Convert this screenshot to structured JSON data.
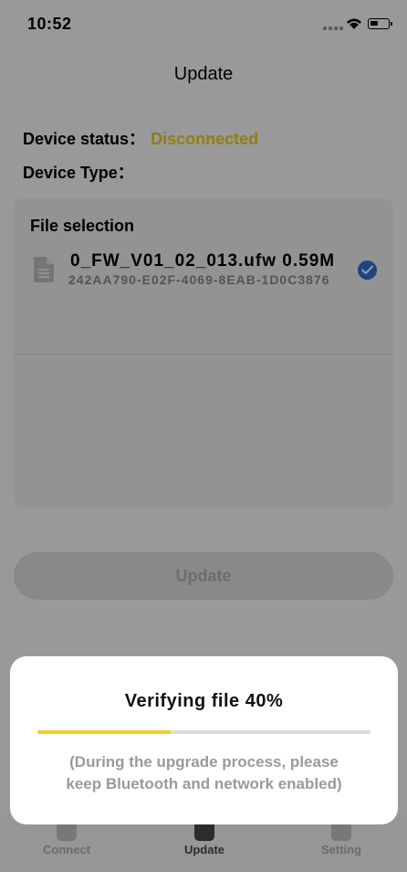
{
  "status_bar": {
    "time": "10:52"
  },
  "nav": {
    "title": "Update"
  },
  "device": {
    "status_label": "Device status：",
    "status_value": "Disconnected",
    "status_color": "#f2d21c",
    "type_label": "Device Type："
  },
  "file_selection": {
    "title": "File selection",
    "files": [
      {
        "name": "0_FW_V01_02_013.ufw  0.59M",
        "id": "242AA790-E02F-4069-8EAB-1D0C3876",
        "selected": true
      }
    ]
  },
  "update_button": {
    "label": "Update"
  },
  "tabs": [
    {
      "label": "Connect",
      "icon": "link-icon",
      "active": false
    },
    {
      "label": "Update",
      "icon": "upload-icon",
      "active": true
    },
    {
      "label": "Setting",
      "icon": "gear-icon",
      "active": false
    }
  ],
  "dialog": {
    "title": "Verifying file  40%",
    "progress_percent": 40,
    "progress_color": "#f4cf22",
    "note_line1": "(During the upgrade process, please",
    "note_line2": "keep Bluetooth and network enabled)"
  }
}
